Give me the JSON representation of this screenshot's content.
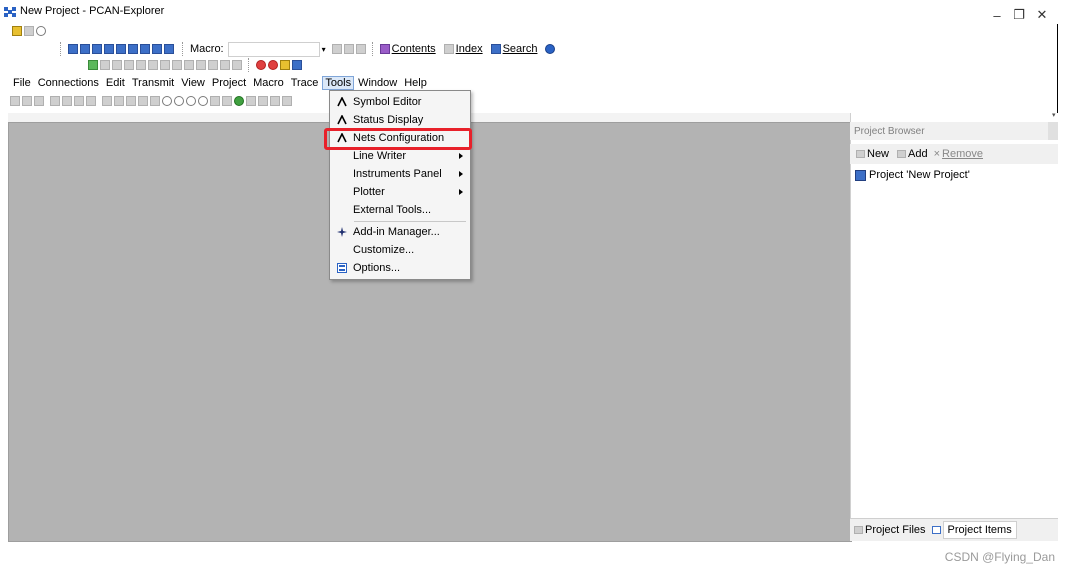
{
  "window": {
    "title": "New Project - PCAN-Explorer",
    "minimize": "–",
    "maximize": "❐",
    "close": "✕"
  },
  "toolbar": {
    "macro_label": "Macro:",
    "macro_value": "",
    "contents": "Contents",
    "index": "Index",
    "search": "Search"
  },
  "menubar": {
    "items": [
      "File",
      "Connections",
      "Edit",
      "Transmit",
      "View",
      "Project",
      "Macro",
      "Trace",
      "Tools",
      "Window",
      "Help"
    ]
  },
  "tools_menu": {
    "items": [
      {
        "label": "Symbol Editor",
        "icon": "symbol-icon",
        "submenu": false
      },
      {
        "label": "Status Display",
        "icon": "status-icon",
        "submenu": false
      },
      {
        "label": "Nets Configuration",
        "icon": "nets-icon",
        "submenu": false
      },
      {
        "label": "Line Writer",
        "icon": "",
        "submenu": true
      },
      {
        "label": "Instruments Panel",
        "icon": "",
        "submenu": true
      },
      {
        "label": "Plotter",
        "icon": "",
        "submenu": true
      },
      {
        "label": "External Tools...",
        "icon": "",
        "submenu": false
      },
      {
        "label": "Add-in Manager...",
        "icon": "addin-icon",
        "submenu": false
      },
      {
        "label": "Customize...",
        "icon": "",
        "submenu": false
      },
      {
        "label": "Options...",
        "icon": "options-icon",
        "submenu": false
      }
    ]
  },
  "project_browser": {
    "title": "Project Browser",
    "new": "New",
    "add": "Add",
    "remove": "Remove",
    "project_node": "Project 'New Project'",
    "tab_files": "Project Files",
    "tab_items": "Project Items"
  },
  "watermark": "CSDN @Flying_Dan",
  "colors": {
    "highlight": "#e8212a",
    "mdi_background": "#b3b3b3"
  }
}
